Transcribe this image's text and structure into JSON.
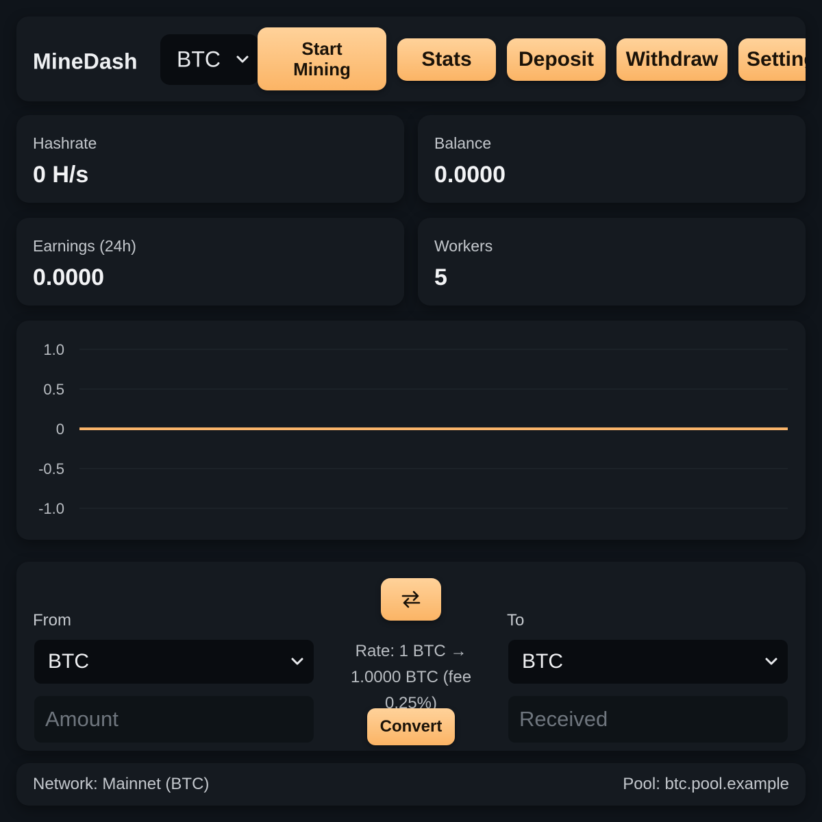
{
  "header": {
    "brand": "MineDash",
    "coin_select": {
      "value": "BTC"
    },
    "buttons": {
      "start_mining": "Start Mining",
      "stats": "Stats",
      "deposit": "Deposit",
      "withdraw": "Withdraw",
      "settings": "Settings"
    }
  },
  "stats": [
    {
      "label": "Hashrate",
      "value": "0 H/s"
    },
    {
      "label": "Balance",
      "value": "0.0000"
    },
    {
      "label": "Earnings (24h)",
      "value": "0.0000"
    },
    {
      "label": "Workers",
      "value": "5"
    }
  ],
  "chart_data": {
    "type": "line",
    "title": "",
    "xlabel": "",
    "ylabel": "",
    "ylim": [
      -1.0,
      1.0
    ],
    "y_ticks": [
      "1.0",
      "0.5",
      "0",
      "-0.5",
      "-1.0"
    ],
    "grid": true,
    "series": [
      {
        "values": [
          0,
          0
        ]
      }
    ],
    "colors": {
      "line": "#f9b46a"
    }
  },
  "converter": {
    "from_label": "From",
    "to_label": "To",
    "from_value": "BTC",
    "to_value": "BTC",
    "amount_placeholder": "Amount",
    "received_placeholder": "Received",
    "swap_icon": "swap-arrows-icon",
    "rate_text": "Rate: 1 BTC → 1.0000 BTC (fee 0.25%)",
    "convert_label": "Convert"
  },
  "footer": {
    "network": "Network: Mainnet (BTC)",
    "pool": "Pool: btc.pool.example"
  },
  "colors": {
    "accent": "#fbb465",
    "background": "#0f141a",
    "card": "#151a20"
  }
}
